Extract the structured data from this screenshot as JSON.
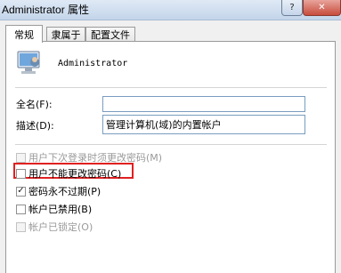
{
  "window": {
    "title": "Administrator 属性",
    "help_glyph": "?",
    "close_glyph": "✕"
  },
  "tabs": [
    {
      "label": "常规",
      "active": true
    },
    {
      "label": "隶属于",
      "active": false
    },
    {
      "label": "配置文件",
      "active": false
    }
  ],
  "user": {
    "name": "Administrator",
    "icon": "user-computer-icon"
  },
  "fields": {
    "fullname_label": "全名(F):",
    "fullname_value": "",
    "description_label": "描述(D):",
    "description_value": "管理计算机(域)的内置帐户"
  },
  "checkboxes": [
    {
      "label": "用户下次登录时须更改密码(M)",
      "checked": false,
      "enabled": false
    },
    {
      "label": "用户不能更改密码(C)",
      "checked": false,
      "enabled": true,
      "highlighted": true
    },
    {
      "label": "密码永不过期(P)",
      "checked": true,
      "enabled": true
    },
    {
      "label": "帐户已禁用(B)",
      "checked": false,
      "enabled": true
    },
    {
      "label": "帐户已锁定(O)",
      "checked": false,
      "enabled": false
    }
  ],
  "colors": {
    "highlight": "#e02020",
    "close_button": "#c74c3d"
  }
}
